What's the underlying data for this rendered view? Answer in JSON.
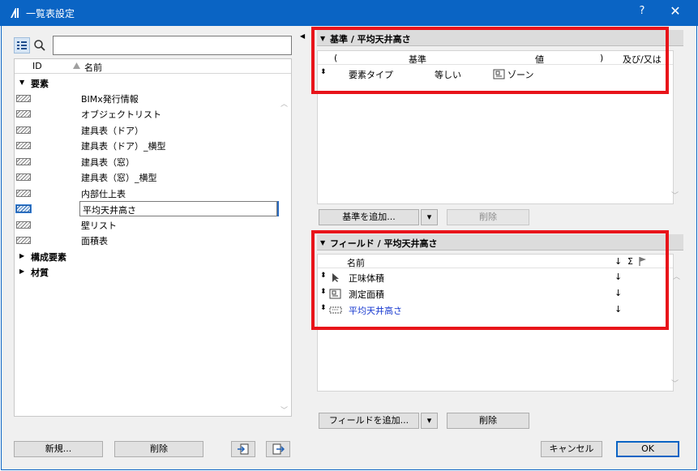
{
  "window": {
    "title": "一覧表設定",
    "help_label": "?",
    "close_label": "✕",
    "accent": "#0a64c4"
  },
  "left": {
    "search": {
      "value": "",
      "placeholder": ""
    },
    "columns": {
      "id": "ID",
      "name": "名前"
    },
    "groups": [
      {
        "label": "要素",
        "expanded": true
      },
      {
        "label": "構成要素",
        "expanded": false
      },
      {
        "label": "材質",
        "expanded": false
      }
    ],
    "items": [
      "BIMx発行情報",
      "オブジェクトリスト",
      "建具表（ドア）",
      "建具表（ドア）_横型",
      "建具表（窓）",
      "建具表（窓）_横型",
      "内部仕上表",
      "平均天井高さ",
      "壁リスト",
      "面積表"
    ],
    "selected_item": "平均天井高さ",
    "buttons": {
      "new": "新規...",
      "delete": "削除"
    }
  },
  "criteria": {
    "header": "基準 /  平均天井高さ",
    "columns": {
      "paren_open": "(",
      "criterion": "基準",
      "value": "値",
      "paren_close": ")",
      "and_or": "及び/又は"
    },
    "rows": [
      {
        "criterion": "要素タイプ",
        "operator": "等しい",
        "value": "ゾーン",
        "value_icon": "zone-icon"
      }
    ],
    "add_button": "基準を追加...",
    "delete_button": "削除"
  },
  "fields": {
    "header": "フィールド /  平均天井高さ",
    "columns": {
      "name": "名前",
      "sort": "↓",
      "sum": "Σ",
      "flag": "flag-icon"
    },
    "rows": [
      {
        "name": "正味体積",
        "icon": "cursor-icon",
        "sort": "↓",
        "linked": false
      },
      {
        "name": "測定面積",
        "icon": "zone-icon",
        "sort": "↓",
        "linked": false
      },
      {
        "name": "平均天井高さ",
        "icon": "dashed-box-icon",
        "sort": "↓",
        "linked": true
      }
    ],
    "add_button": "フィールドを追加...",
    "delete_button": "削除"
  },
  "footer": {
    "cancel": "キャンセル",
    "ok": "OK"
  },
  "highlight_color": "#e8141a"
}
